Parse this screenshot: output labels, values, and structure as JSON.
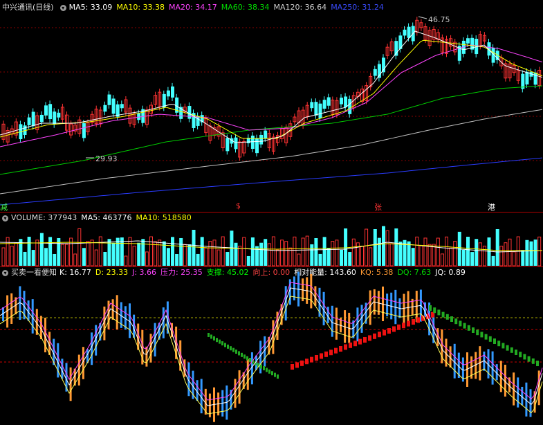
{
  "main": {
    "stock_name": "中兴通讯(日线)",
    "ma5": "MA5: 33.09",
    "ma10": "MA10: 33.38",
    "ma20": "MA20: 34.17",
    "ma60": "MA60: 38.34",
    "ma120": "MA120: 36.64",
    "ma250": "MA250: 31.24",
    "high_label": "46.75",
    "low_label": "29.93",
    "markers": [
      "减",
      "$",
      "张",
      "港"
    ]
  },
  "volume": {
    "title": "VOLUME: 377943",
    "ma5": "MA5: 463776",
    "ma10": "MA10: 518580"
  },
  "indicator": {
    "title": "买卖一看便知",
    "k": "K: 16.77",
    "d": "D: 23.33",
    "j": "J: 3.66",
    "pressure": "压力: 25.35",
    "support": "支撑: 45.02",
    "up": "向上: 0.00",
    "energy": "相对能量: 143.60",
    "kq": "KQ: 5.38",
    "dq": "DQ: 7.63",
    "jq": "JQ: 0.89"
  },
  "colors": {
    "ma5": "#ffffff",
    "ma10": "#ffff00",
    "ma20": "#ff44ff",
    "ma60": "#00cc00",
    "ma120": "#c0c0c0",
    "ma250": "#2a3cff",
    "up": "#ff3333",
    "down": "#44ffff",
    "grid": "#8a0000",
    "k_line": "#ffffff",
    "d_line": "#ffff55",
    "j_line": "#ff44ff"
  }
}
